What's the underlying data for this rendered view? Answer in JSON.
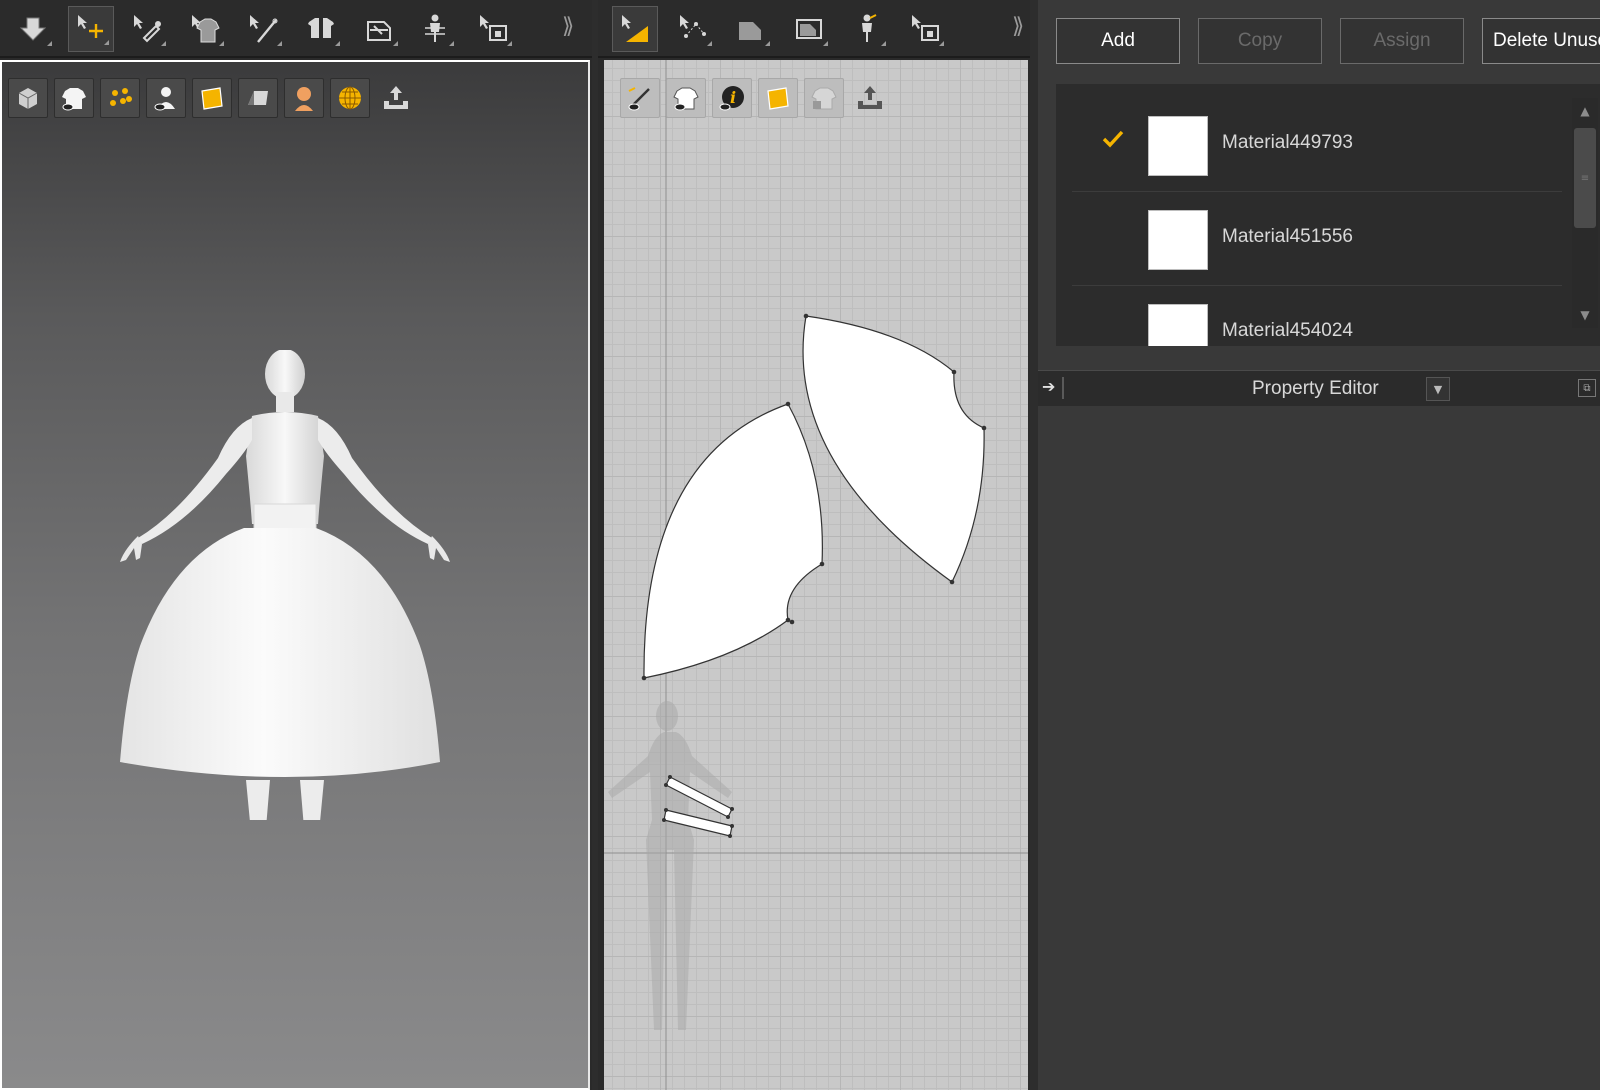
{
  "left_toolbar": {
    "tools": [
      {
        "icon": "arrow-down-icon"
      },
      {
        "icon": "select-move-icon",
        "active": true
      },
      {
        "icon": "edit-pin-icon"
      },
      {
        "icon": "garment-select-icon"
      },
      {
        "icon": "needle-icon"
      },
      {
        "icon": "fold-arrangement-icon"
      },
      {
        "icon": "tack-icon"
      },
      {
        "icon": "avatar-measure-icon"
      },
      {
        "icon": "sewing-machine-icon"
      }
    ],
    "expand_label": "⟫"
  },
  "viewport_3d": {
    "icons": [
      "texture-cube-icon",
      "show-garment-icon",
      "particle-distance-icon",
      "show-avatar-icon",
      "texture-sheet-icon",
      "dark-sheet-icon",
      "skin-avatar-icon",
      "globe-grid-icon",
      "export-upload-icon"
    ]
  },
  "mid_toolbar": {
    "tools": [
      {
        "icon": "transform-pattern-icon",
        "active": true
      },
      {
        "icon": "edit-points-icon"
      },
      {
        "icon": "polygon-icon"
      },
      {
        "icon": "rectangle-icon"
      },
      {
        "icon": "avatar-pin-icon"
      },
      {
        "icon": "sew-segment-icon"
      }
    ],
    "expand_label": "⟫"
  },
  "viewport_2d": {
    "icons": [
      "show-pattern-line-icon",
      "show-garment-2d-icon",
      "pattern-info-icon",
      "texture-2d-icon",
      "locked-garment-icon",
      "export-2d-icon"
    ]
  },
  "materials": {
    "buttons": {
      "add": "Add",
      "copy": "Copy",
      "assign": "Assign",
      "delete_unused": "Delete Unused"
    },
    "items": [
      {
        "name": "Material449793",
        "selected": true,
        "color": "#ffffff"
      },
      {
        "name": "Material451556",
        "selected": false,
        "color": "#ffffff"
      },
      {
        "name": "Material454024",
        "selected": false,
        "color": "#ffffff"
      }
    ],
    "accent": "#f5b400"
  },
  "property_editor": {
    "title": "Property Editor"
  }
}
